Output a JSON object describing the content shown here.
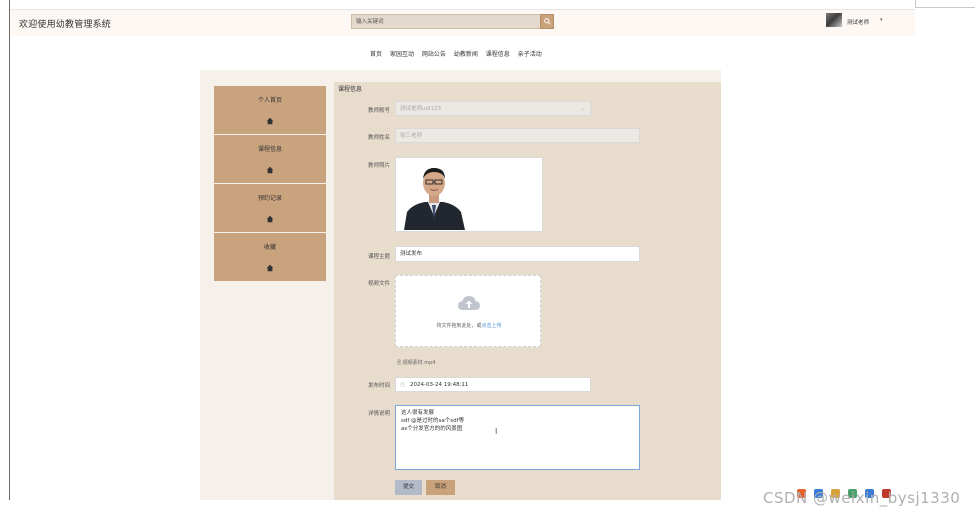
{
  "header": {
    "site_title": "欢迎使用幼教管理系统",
    "search_placeholder": "输入关键词",
    "username": "测试老师",
    "caret": "▾"
  },
  "nav": {
    "items": [
      "首页",
      "家园互动",
      "网站公告",
      "幼教新闻",
      "课程信息",
      "亲子活动"
    ]
  },
  "sidebar": {
    "items": [
      {
        "label": "个人首页"
      },
      {
        "label": "课程信息"
      },
      {
        "label": "预约记录"
      },
      {
        "label": "收藏"
      }
    ]
  },
  "form": {
    "section_title": "课程信息",
    "teacher_id_label": "教师账号",
    "teacher_id_value": "测试老师uid123",
    "teacher_name_label": "教师姓名",
    "teacher_name_value": "张三老师",
    "teacher_photo_label": "教师照片",
    "course_topic_label": "课程主题",
    "course_topic_value": "测试发布",
    "video_file_label": "视频文件",
    "upload_hint": "将文件拖到此处，或",
    "upload_link": "点击上传",
    "uploaded_file": "视频素材.mp4",
    "publish_time_label": "发布时间",
    "publish_time_value": "2024-03-24 19:48:11",
    "detail_label": "详情说明",
    "detail_lines": [
      "这人很有发展",
      "sdf @是过时的sa个sdf等",
      "as个分发官方的的风景图"
    ],
    "submit_label": "提交",
    "cancel_label": "取消"
  },
  "watermark": "CSDN @weixin_bysj1330",
  "colors": {
    "accent": "#c9a27e",
    "form_bg": "#e8dccd",
    "header_bg": "#fdf8f3",
    "submit_bg": "#b3bac7"
  }
}
